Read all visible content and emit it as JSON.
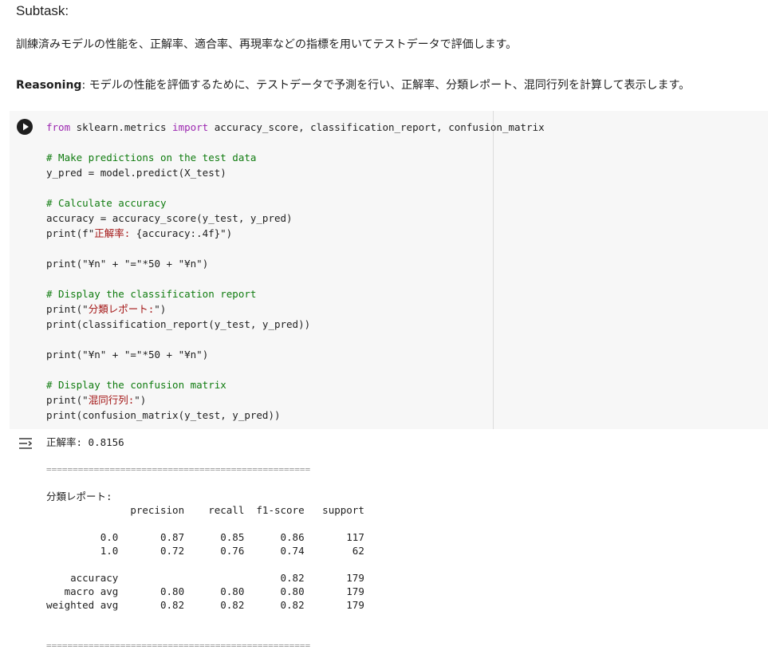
{
  "markdown": {
    "heading": "Subtask:",
    "description": "訓練済みモデルの性能を、正解率、適合率、再現率などの指標を用いてテストデータで評価します。",
    "reasoning_label": "Reasoning",
    "reasoning_text": ": モデルの性能を評価するために、テストデータで予測を行い、正解率、分類レポート、混同行列を計算して表示します。"
  },
  "code_lines": [
    [
      {
        "t": "from",
        "c": "kw"
      },
      {
        "t": " sklearn.metrics ",
        "c": ""
      },
      {
        "t": "import",
        "c": "kw"
      },
      {
        "t": " accuracy_score, classification_report, confusion_matrix",
        "c": ""
      }
    ],
    [],
    [
      {
        "t": "# Make predictions on the test data",
        "c": "cm"
      }
    ],
    [
      {
        "t": "y_pred = model.predict(X_test)",
        "c": ""
      }
    ],
    [],
    [
      {
        "t": "# Calculate accuracy",
        "c": "cm"
      }
    ],
    [
      {
        "t": "accuracy = accuracy_score(y_test, y_pred)",
        "c": ""
      }
    ],
    [
      {
        "t": "print",
        "c": ""
      },
      {
        "t": "(f\"",
        "c": ""
      },
      {
        "t": "正解率: ",
        "c": "st"
      },
      {
        "t": "{accuracy:.4f}",
        "c": ""
      },
      {
        "t": "\")",
        "c": ""
      }
    ],
    [],
    [
      {
        "t": "print",
        "c": ""
      },
      {
        "t": "(\"¥n\"",
        "c": ""
      },
      {
        "t": " + ",
        "c": ""
      },
      {
        "t": "\"=\"",
        "c": ""
      },
      {
        "t": "*50 + ",
        "c": ""
      },
      {
        "t": "\"¥n\"",
        "c": ""
      },
      {
        "t": ")",
        "c": ""
      }
    ],
    [],
    [
      {
        "t": "# Display the classification report",
        "c": "cm"
      }
    ],
    [
      {
        "t": "print(\"",
        "c": ""
      },
      {
        "t": "分類レポート:",
        "c": "st"
      },
      {
        "t": "\")",
        "c": ""
      }
    ],
    [
      {
        "t": "print(classification_report(y_test, y_pred))",
        "c": ""
      }
    ],
    [],
    [
      {
        "t": "print",
        "c": ""
      },
      {
        "t": "(\"¥n\"",
        "c": ""
      },
      {
        "t": " + ",
        "c": ""
      },
      {
        "t": "\"=\"",
        "c": ""
      },
      {
        "t": "*50 + ",
        "c": ""
      },
      {
        "t": "\"¥n\"",
        "c": ""
      },
      {
        "t": ")",
        "c": ""
      }
    ],
    [],
    [
      {
        "t": "# Display the confusion matrix",
        "c": "cm"
      }
    ],
    [
      {
        "t": "print(\"",
        "c": ""
      },
      {
        "t": "混同行列:",
        "c": "st"
      },
      {
        "t": "\")",
        "c": ""
      }
    ],
    [
      {
        "t": "print(confusion_matrix(y_test, y_pred))",
        "c": ""
      }
    ]
  ],
  "output_lines": [
    "正解率: 0.8156",
    "",
    "==================================================",
    "",
    "分類レポート:",
    "              precision    recall  f1-score   support",
    "",
    "         0.0       0.87      0.85      0.86       117",
    "         1.0       0.72      0.76      0.74        62",
    "",
    "    accuracy                           0.82       179",
    "   macro avg       0.80      0.80      0.80       179",
    "weighted avg       0.82      0.82      0.82       179",
    "",
    "",
    "=================================================="
  ]
}
